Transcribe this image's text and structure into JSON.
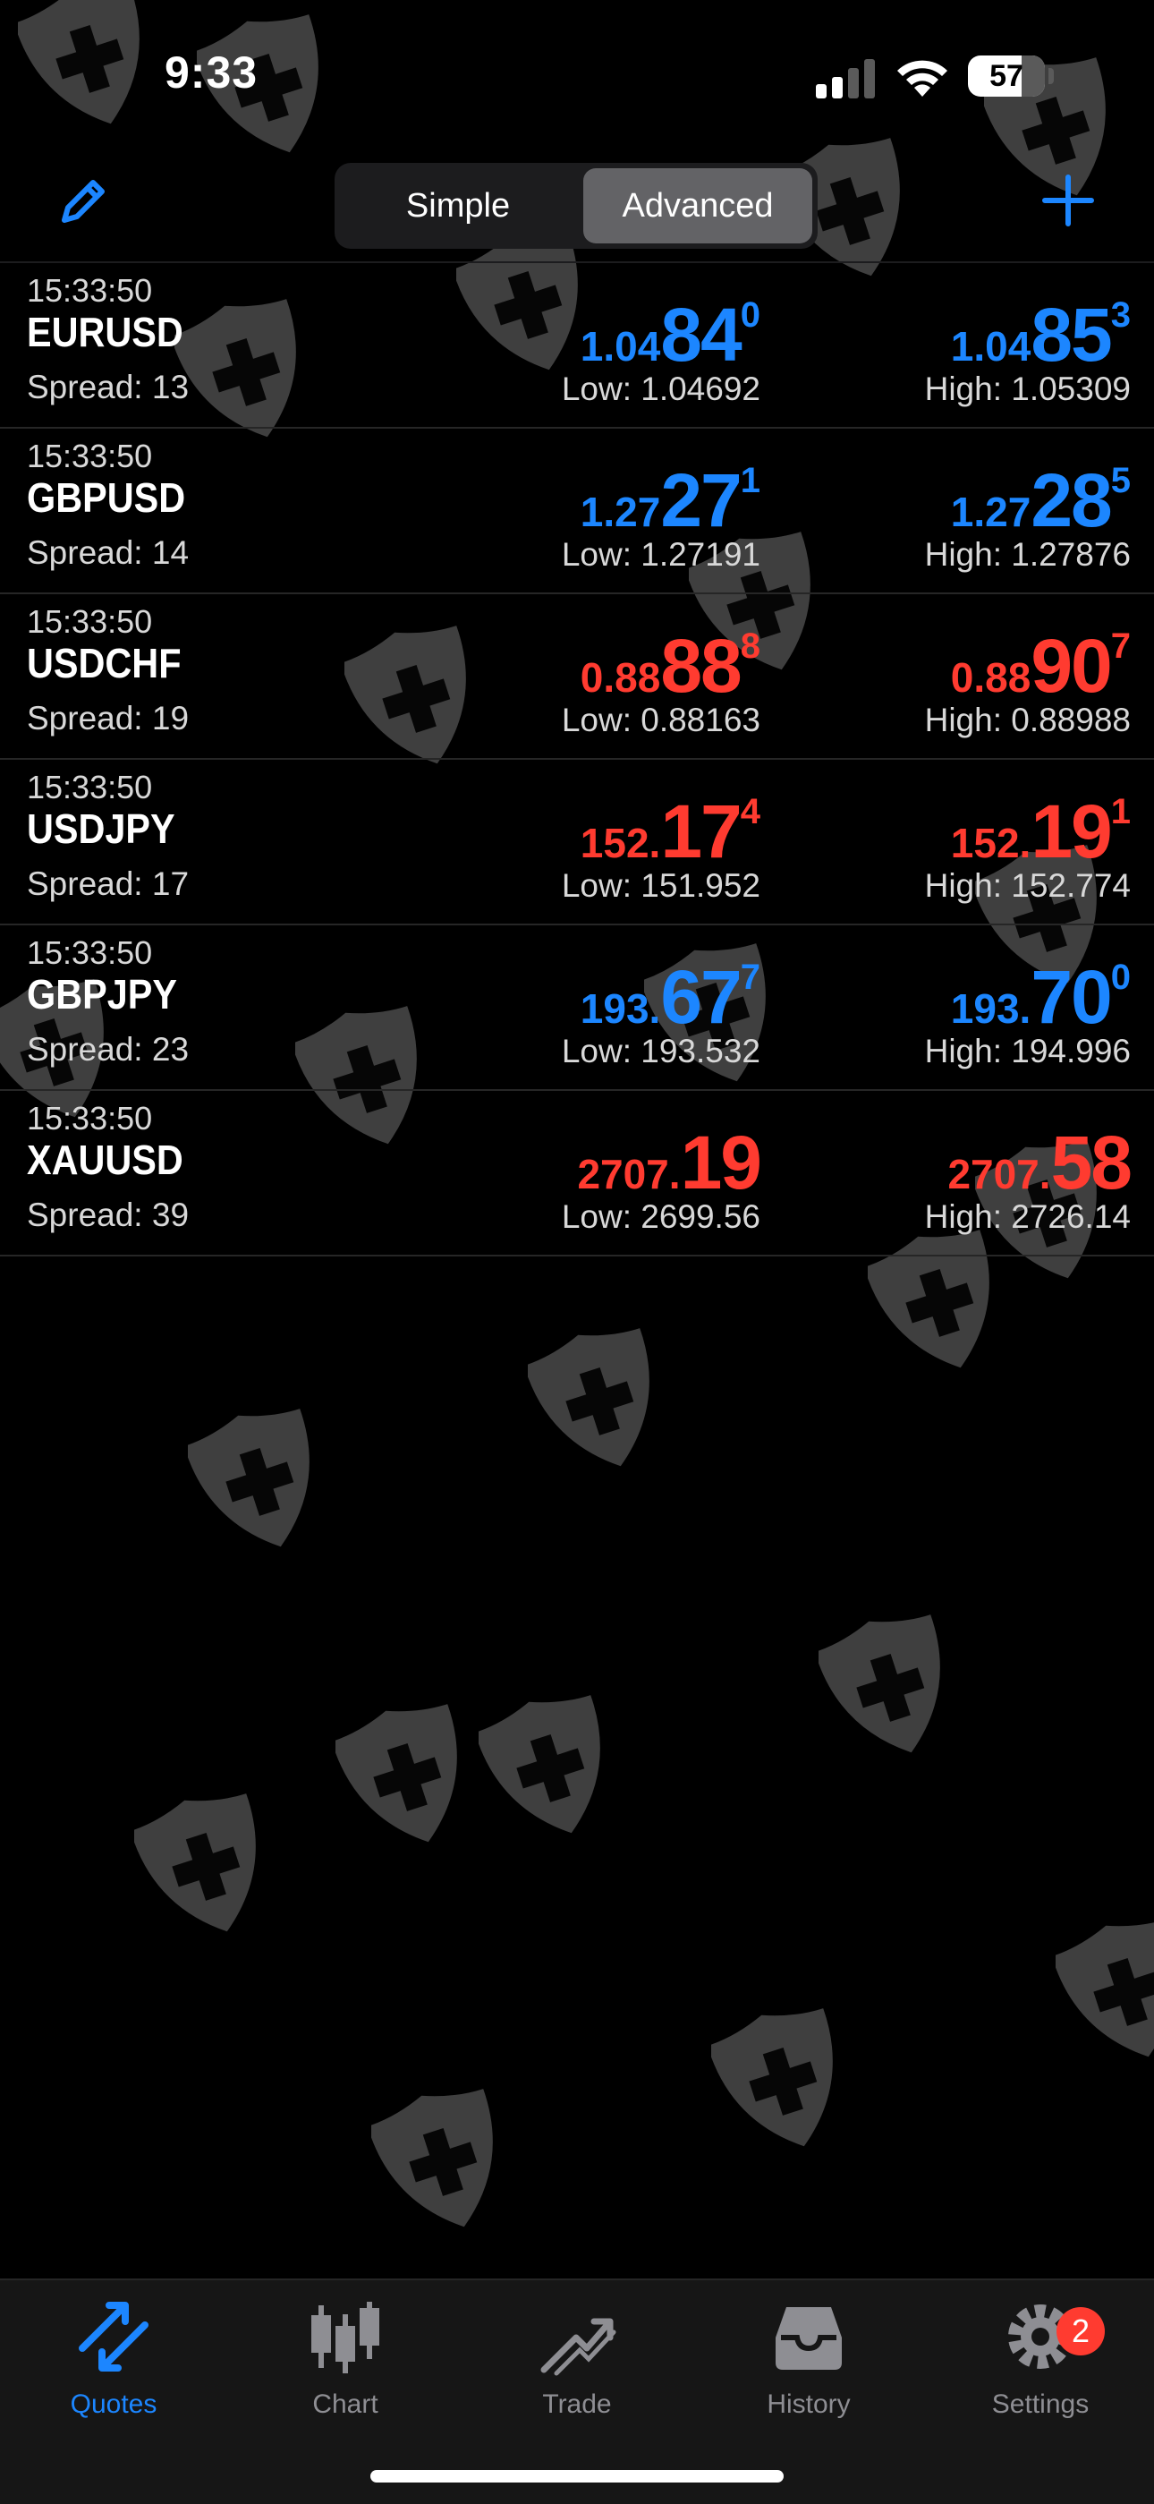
{
  "status_bar": {
    "time": "9:33",
    "battery": "57"
  },
  "segment": {
    "simple_label": "Simple",
    "advanced_label": "Advanced",
    "selected": "Advanced"
  },
  "quotes": [
    {
      "time": "15:33:50",
      "symbol": "EURUSD",
      "spread": "Spread: 13",
      "bid": {
        "small": "1.04",
        "big": "84",
        "sup": "0"
      },
      "ask": {
        "small": "1.04",
        "big": "85",
        "sup": "3"
      },
      "direction": "up",
      "low": "Low: 1.04692",
      "high": "High: 1.05309"
    },
    {
      "time": "15:33:50",
      "symbol": "GBPUSD",
      "spread": "Spread: 14",
      "bid": {
        "small": "1.27",
        "big": "27",
        "sup": "1"
      },
      "ask": {
        "small": "1.27",
        "big": "28",
        "sup": "5"
      },
      "direction": "up",
      "low": "Low: 1.27191",
      "high": "High: 1.27876"
    },
    {
      "time": "15:33:50",
      "symbol": "USDCHF",
      "spread": "Spread: 19",
      "bid": {
        "small": "0.88",
        "big": "88",
        "sup": "8"
      },
      "ask": {
        "small": "0.88",
        "big": "90",
        "sup": "7"
      },
      "direction": "down",
      "low": "Low: 0.88163",
      "high": "High: 0.88988"
    },
    {
      "time": "15:33:50",
      "symbol": "USDJPY",
      "spread": "Spread: 17",
      "bid": {
        "small": "152.",
        "big": "17",
        "sup": "4"
      },
      "ask": {
        "small": "152.",
        "big": "19",
        "sup": "1"
      },
      "direction": "down",
      "low": "Low: 151.952",
      "high": "High: 152.774"
    },
    {
      "time": "15:33:50",
      "symbol": "GBPJPY",
      "spread": "Spread: 23",
      "bid": {
        "small": "193.",
        "big": "67",
        "sup": "7"
      },
      "ask": {
        "small": "193.",
        "big": "70",
        "sup": "0"
      },
      "direction": "up",
      "low": "Low: 193.532",
      "high": "High: 194.996"
    },
    {
      "time": "15:33:50",
      "symbol": "XAUUSD",
      "spread": "Spread: 39",
      "bid": {
        "small": "2707.",
        "big": "19",
        "sup": ""
      },
      "ask": {
        "small": "2707.",
        "big": "58",
        "sup": ""
      },
      "direction": "down",
      "low": "Low: 2699.56",
      "high": "High: 2726.14"
    }
  ],
  "tabs": [
    {
      "label": "Quotes",
      "icon": "quotes-icon",
      "active": true
    },
    {
      "label": "Chart",
      "icon": "chart-icon",
      "active": false
    },
    {
      "label": "Trade",
      "icon": "trade-icon",
      "active": false
    },
    {
      "label": "History",
      "icon": "history-icon",
      "active": false
    },
    {
      "label": "Settings",
      "icon": "settings-icon",
      "active": false,
      "badge": "2"
    }
  ],
  "colors": {
    "up": "#1c86ff",
    "down": "#ff3b30",
    "accent": "#1c86ff"
  }
}
